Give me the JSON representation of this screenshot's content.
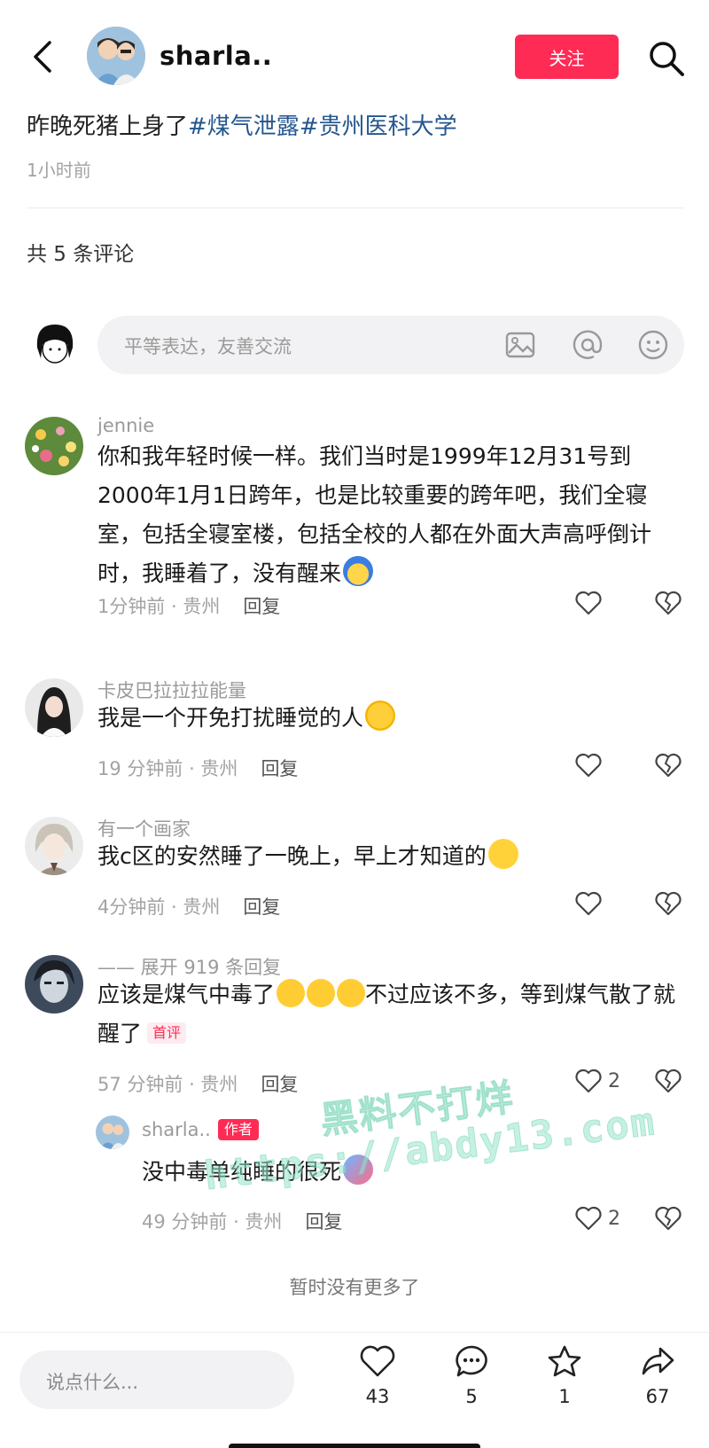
{
  "header": {
    "author_name": "sharla..",
    "follow_label": "关注"
  },
  "post": {
    "text_plain": "昨晚死猪上身了",
    "tags": [
      "#煤气泄露",
      "#贵州医科大学"
    ],
    "time": "1小时前"
  },
  "comments_header": "共 5 条评论",
  "input": {
    "placeholder": "平等表达，友善交流"
  },
  "comments": [
    {
      "user": "jennie",
      "text": "你和我年轻时候一样。我们当时是1999年12月31号到2000年1月1日跨年，也是比较重要的跨年吧，我们全寝室，包括全寝室楼，包括全校的人都在外面大声高呼倒计时，我睡着了，没有醒来",
      "meta": "1分钟前 · 贵州",
      "reply": "回复"
    },
    {
      "user": "卡皮巴拉拉拉能量",
      "text": "我是一个开免打扰睡觉的人",
      "meta": "19 分钟前 · 贵州",
      "reply": "回复"
    },
    {
      "user": "有一个画家",
      "text": "我c区的安然睡了一晚上，早上才知道的",
      "meta": "4分钟前 · 贵州",
      "reply": "回复"
    },
    {
      "user": "—— 展开 919 条回复",
      "text_a": "应该是煤气中毒了",
      "text_b": "不过应该不多，等到煤气散了就醒了",
      "badge": "首评",
      "meta": "57 分钟前 · 贵州",
      "reply": "回复",
      "likes": "2"
    }
  ],
  "author_reply": {
    "user": "sharla..",
    "badge": "作者",
    "text": "没中毒单纯睡的很死",
    "meta": "49 分钟前 · 贵州",
    "reply": "回复",
    "likes": "2"
  },
  "no_more": "暂时没有更多了",
  "watermark": {
    "line1": "黑料不打烊",
    "line2": "https://abdy13.com"
  },
  "bottom": {
    "placeholder": "说点什么...",
    "like_count": "43",
    "comment_count": "5",
    "favorite_count": "1",
    "share_count": "67"
  },
  "colors": {
    "accent": "#fe2c55",
    "tag": "#24568f"
  }
}
